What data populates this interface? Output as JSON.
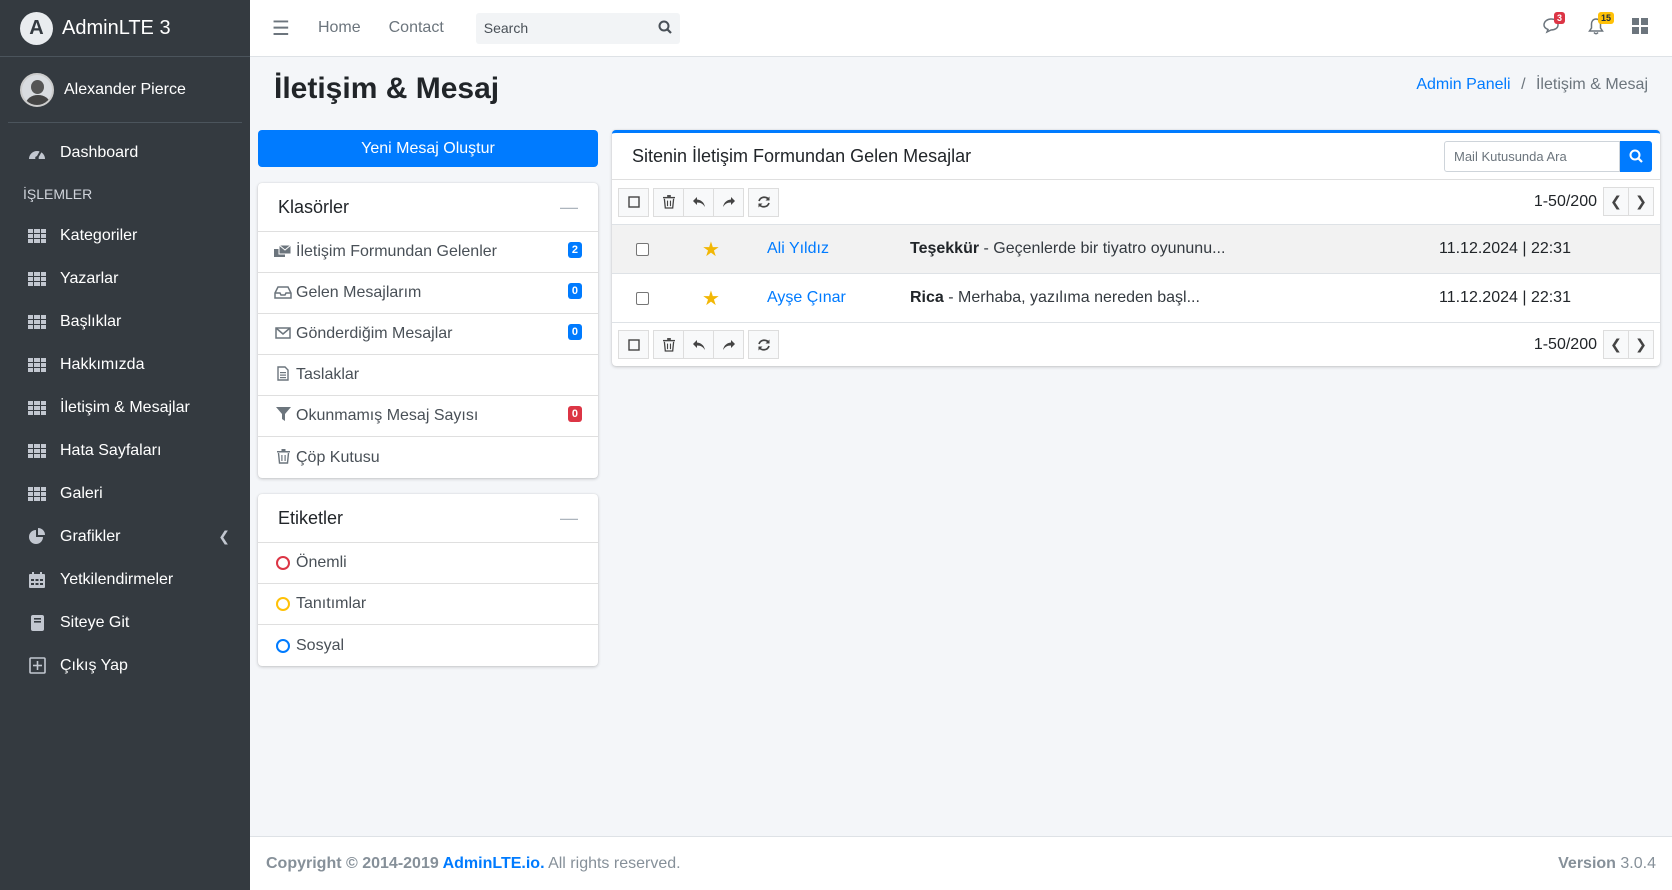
{
  "brand": {
    "name": "AdminLTE 3",
    "logo_letter": "A"
  },
  "user": {
    "name": "Alexander Pierce"
  },
  "sidebar": {
    "dashboard": "Dashboard",
    "section_header": "İŞLEMLER",
    "items": [
      {
        "label": "Kategoriler",
        "icon": "grid-icon"
      },
      {
        "label": "Yazarlar",
        "icon": "grid-icon"
      },
      {
        "label": "Başlıklar",
        "icon": "grid-icon"
      },
      {
        "label": "Hakkımızda",
        "icon": "grid-icon"
      },
      {
        "label": "İletişim & Mesajlar",
        "icon": "grid-icon"
      },
      {
        "label": "Hata Sayfaları",
        "icon": "grid-icon"
      },
      {
        "label": "Galeri",
        "icon": "grid-icon"
      }
    ],
    "grafikler": "Grafikler",
    "yetkilendirmeler": "Yetkilendirmeler",
    "siteye_git": "Siteye Git",
    "cikis": "Çıkış Yap"
  },
  "topbar": {
    "home": "Home",
    "contact": "Contact",
    "search_placeholder": "Search",
    "messages_count": "3",
    "notifications_count": "15"
  },
  "page": {
    "title": "İletişim & Mesaj",
    "breadcrumb_link": "Admin Paneli",
    "breadcrumb_sep": "/",
    "breadcrumb_current": "İletişim & Mesaj"
  },
  "compose_button": "Yeni Mesaj Oluştur",
  "folders": {
    "title": "Klasörler",
    "items": [
      {
        "label": "İletişim Formundan Gelenler",
        "count": "2",
        "badge_color": "#007bff"
      },
      {
        "label": "Gelen Mesajlarım",
        "count": "0",
        "badge_color": "#007bff"
      },
      {
        "label": "Gönderdiğim Mesajlar",
        "count": "0",
        "badge_color": "#007bff"
      },
      {
        "label": "Taslaklar",
        "count": ""
      },
      {
        "label": "Okunmamış Mesaj Sayısı",
        "count": "0",
        "badge_color": "#dc3545"
      },
      {
        "label": "Çöp Kutusu",
        "count": ""
      }
    ]
  },
  "labels": {
    "title": "Etiketler",
    "items": [
      {
        "label": "Önemli",
        "color": "#dc3545"
      },
      {
        "label": "Tanıtımlar",
        "color": "#ffc107"
      },
      {
        "label": "Sosyal",
        "color": "#007bff"
      }
    ]
  },
  "mailbox": {
    "title": "Sitenin İletişim Formundan Gelen Mesajlar",
    "search_placeholder": "Mail Kutusunda Ara",
    "pager": "1-50/200",
    "messages": [
      {
        "sender": "Ali Yıldız",
        "subject": "Teşekkür",
        "preview": " - Geçenlerde bir tiyatro oyununu...",
        "date": "11.12.2024 | 22:31"
      },
      {
        "sender": "Ayşe Çınar",
        "subject": "Rica",
        "preview": " - Merhaba, yazılıma nereden başl...",
        "date": "11.12.2024 | 22:31"
      }
    ]
  },
  "footer": {
    "copyright": "Copyright © 2014-2019 ",
    "link": "AdminLTE.io.",
    "rights": " All rights reserved.",
    "version_label": "Version",
    "version": "3.0.4"
  }
}
